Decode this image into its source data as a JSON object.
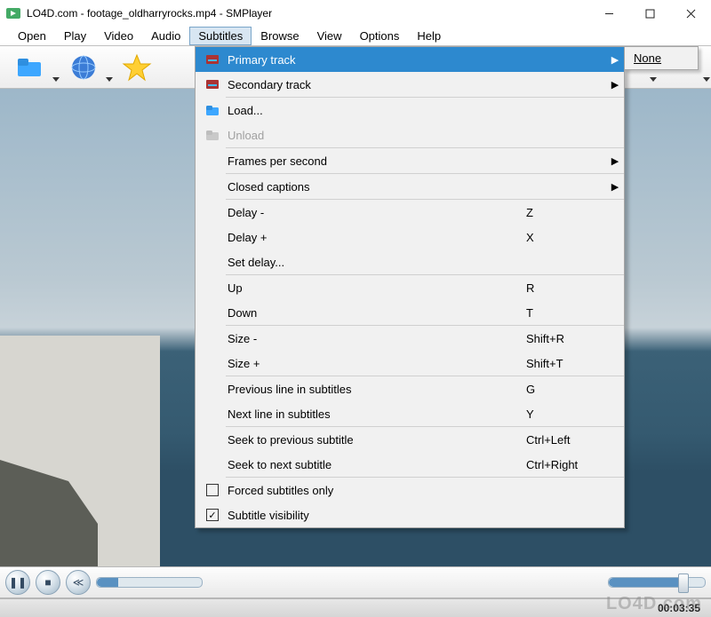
{
  "window": {
    "title": "LO4D.com - footage_oldharryrocks.mp4 - SMPlayer"
  },
  "menubar": {
    "items": [
      {
        "label": "Open",
        "accel": "O"
      },
      {
        "label": "Play",
        "accel": "P"
      },
      {
        "label": "Video",
        "accel": "V"
      },
      {
        "label": "Audio",
        "accel": "A"
      },
      {
        "label": "Subtitles",
        "accel": "S"
      },
      {
        "label": "Browse",
        "accel": "B"
      },
      {
        "label": "View",
        "accel": "V"
      },
      {
        "label": "Options",
        "accel": "O"
      },
      {
        "label": "Help",
        "accel": "H"
      }
    ],
    "open_index": 4
  },
  "toolbar_icons": [
    "folder-icon",
    "globe-icon",
    "star-icon"
  ],
  "subtitles_menu": [
    {
      "type": "item",
      "icon": "subtitle-primary-icon",
      "label": "Primary track",
      "submenu": true,
      "highlight": true
    },
    {
      "type": "item",
      "icon": "subtitle-secondary-icon",
      "label": "Secondary track",
      "submenu": true
    },
    {
      "type": "sep"
    },
    {
      "type": "item",
      "icon": "folder-icon",
      "label": "Load..."
    },
    {
      "type": "item",
      "icon": "folder-dim-icon",
      "label": "Unload",
      "disabled": true
    },
    {
      "type": "sep"
    },
    {
      "type": "item",
      "label": "Frames per second",
      "submenu": true
    },
    {
      "type": "sep"
    },
    {
      "type": "item",
      "label": "Closed captions",
      "submenu": true
    },
    {
      "type": "sep"
    },
    {
      "type": "item",
      "label": "Delay -",
      "shortcut": "Z"
    },
    {
      "type": "item",
      "label": "Delay +",
      "shortcut": "X"
    },
    {
      "type": "item",
      "label": "Set delay..."
    },
    {
      "type": "sep"
    },
    {
      "type": "item",
      "label": "Up",
      "shortcut": "R"
    },
    {
      "type": "item",
      "label": "Down",
      "shortcut": "T"
    },
    {
      "type": "sep"
    },
    {
      "type": "item",
      "label": "Size -",
      "shortcut": "Shift+R"
    },
    {
      "type": "item",
      "label": "Size +",
      "shortcut": "Shift+T"
    },
    {
      "type": "sep"
    },
    {
      "type": "item",
      "label": "Previous line in subtitles",
      "shortcut": "G"
    },
    {
      "type": "item",
      "label": "Next line in subtitles",
      "shortcut": "Y"
    },
    {
      "type": "sep"
    },
    {
      "type": "item",
      "label": "Seek to previous subtitle",
      "shortcut": "Ctrl+Left"
    },
    {
      "type": "item",
      "label": "Seek to next subtitle",
      "shortcut": "Ctrl+Right"
    },
    {
      "type": "sep"
    },
    {
      "type": "check",
      "checked": false,
      "label": "Forced subtitles only"
    },
    {
      "type": "check",
      "checked": true,
      "label": "Subtitle visibility"
    }
  ],
  "primary_track_submenu": {
    "items": [
      "None"
    ]
  },
  "playback": {
    "position_pct": 20,
    "volume_pct": 75,
    "timecode": "00:03:35"
  },
  "watermark": "LO4D.com"
}
